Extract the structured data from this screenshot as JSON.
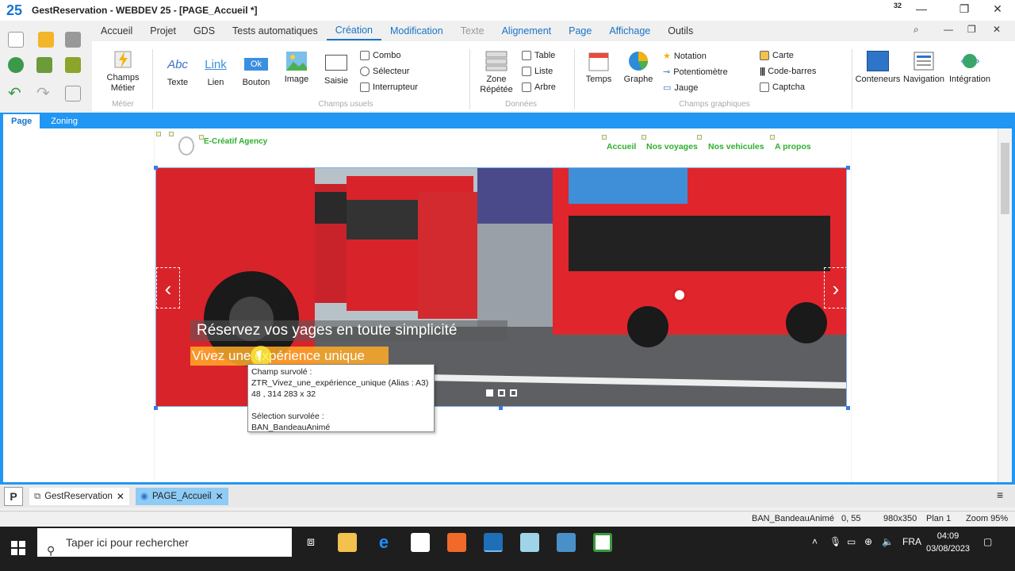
{
  "app": {
    "title": "GestReservation - WEBDEV 25 - [PAGE_Accueil *]",
    "badge": "32"
  },
  "menu": [
    "Accueil",
    "Projet",
    "GDS",
    "Tests automatiques",
    "Création",
    "Modification",
    "Texte",
    "Alignement",
    "Page",
    "Affichage",
    "Outils"
  ],
  "ribbon": {
    "champs_metier": "Champs Métier",
    "group_metier": "Métier",
    "texte": "Texte",
    "texte_icon": "Abc",
    "lien": "Lien",
    "lien_icon": "Link",
    "bouton": "Bouton",
    "bouton_icon": "Ok",
    "image": "Image",
    "saisie": "Saisie",
    "combo": "Combo",
    "selecteur": "Sélecteur",
    "interrupteur": "Interrupteur",
    "group_usuels": "Champs usuels",
    "zone_repetee": "Zone Répétée",
    "table": "Table",
    "liste": "Liste",
    "arbre": "Arbre",
    "group_donnees": "Données",
    "temps": "Temps",
    "graphe": "Graphe",
    "notation": "Notation",
    "potentiometre": "Potentiomètre",
    "jauge": "Jauge",
    "carte": "Carte",
    "code_barres": "Code-barres",
    "captcha": "Captcha",
    "group_graphiques": "Champs graphiques",
    "conteneurs": "Conteneurs",
    "navigation": "Navigation",
    "integration": "Intégration"
  },
  "tabs": {
    "page": "Page",
    "zoning": "Zoning"
  },
  "site": {
    "name": "E-Créatif Agency",
    "nav": [
      "Accueil",
      "Nos voyages",
      "Nos vehicules",
      "A propos"
    ],
    "caption1": "Réservez vos yages en toute simplicité",
    "caption2": "Vivez une expérience unique",
    "prev": "‹",
    "next": "›"
  },
  "tooltip": {
    "line1": "Champ survolé :",
    "line2": "ZTR_Vivez_une_expérience_unique (Alias : A3)",
    "line3": "48 , 314    283 x 32",
    "line4": "Sélection survolée :",
    "line5": "BAN_BandeauAnimé"
  },
  "doctabs": {
    "project": "GestReservation",
    "page": "PAGE_Accueil"
  },
  "status": {
    "control": "BAN_BandeauAnimé",
    "pos": "0, 55",
    "size": "980x350",
    "plan": "Plan 1",
    "zoom": "Zoom 95%"
  },
  "taskbar": {
    "search_placeholder": "Taper ici pour rechercher",
    "lang": "FRA",
    "time": "04:09",
    "date": "03/08/2023"
  },
  "colors": {
    "accent": "#2196f3",
    "site_green": "#2eaf2e",
    "bus_red": "#d9232a"
  }
}
